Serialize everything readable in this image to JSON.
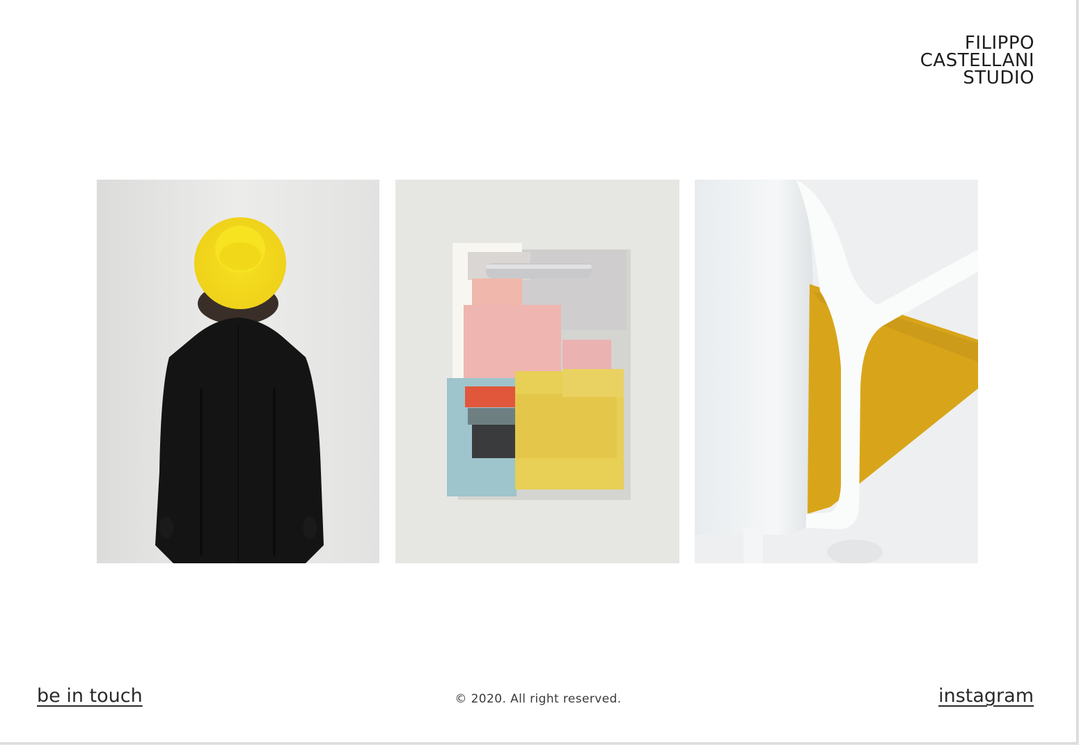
{
  "logo": {
    "line1": "FILIPPO",
    "line2": "CASTELLANI",
    "line3": "STUDIO"
  },
  "gallery": [
    {
      "name": "person-yellow-hat-photo"
    },
    {
      "name": "fabric-swatches-photo"
    },
    {
      "name": "white-chair-yellow-seat-photo"
    }
  ],
  "footer": {
    "contact_link": "be in touch",
    "copyright": "© 2020. All right reserved.",
    "instagram_link": "instagram"
  },
  "colors": {
    "background": "#ffffff",
    "text": "#222222",
    "accent_yellow": "#f2d91e"
  }
}
